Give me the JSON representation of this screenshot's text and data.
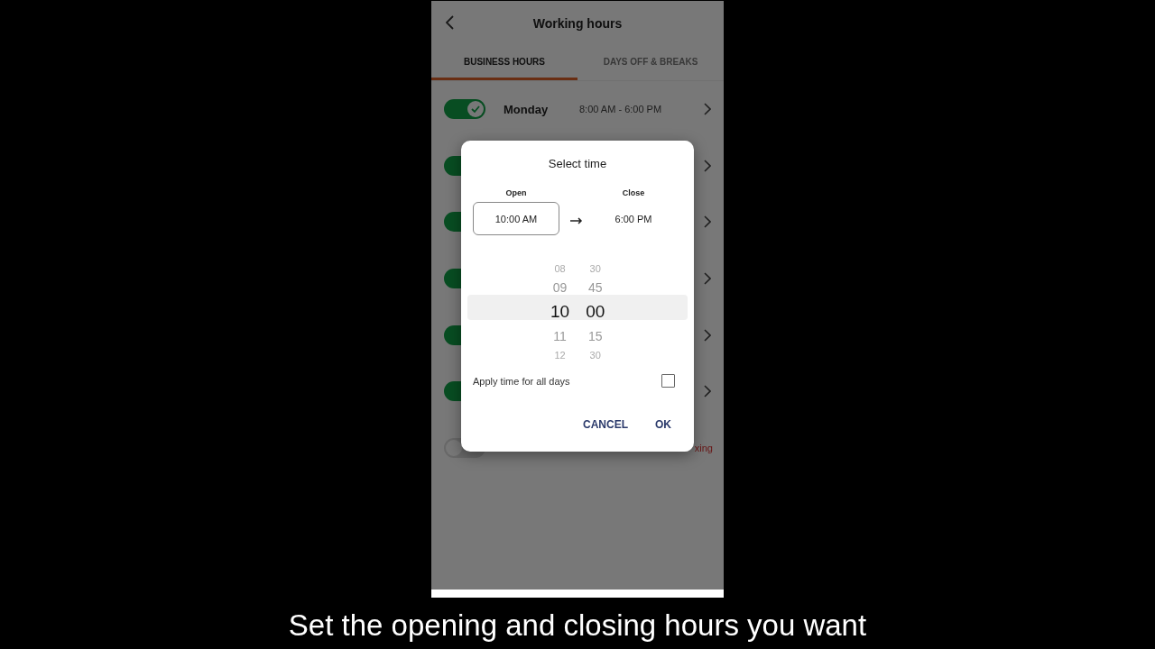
{
  "header": {
    "title": "Working hours"
  },
  "tabs": [
    {
      "label": "BUSINESS HOURS",
      "selected": true
    },
    {
      "label": "DAYS OFF & BREAKS",
      "selected": false
    }
  ],
  "days": [
    {
      "name": "Monday",
      "hours": "8:00 AM  - 6:00 PM",
      "on": true
    },
    {
      "on": true
    },
    {
      "on": true
    },
    {
      "on": true
    },
    {
      "on": true
    },
    {
      "on": true
    }
  ],
  "footer_row": {
    "on": false,
    "text": "xing"
  },
  "dialog": {
    "title": "Select time",
    "open_label": "Open",
    "open_value": "10:00 AM",
    "close_label": "Close",
    "close_value": "6:00 PM",
    "hours": [
      {
        "label": "08",
        "selected": false
      },
      {
        "label": "09",
        "selected": false
      },
      {
        "label": "10",
        "selected": true
      },
      {
        "label": "11",
        "selected": false
      },
      {
        "label": "12",
        "selected": false
      }
    ],
    "minutes": [
      {
        "label": "30",
        "selected": false
      },
      {
        "label": "45",
        "selected": false
      },
      {
        "label": "00",
        "selected": true
      },
      {
        "label": "15",
        "selected": false
      },
      {
        "label": "30",
        "selected": false
      }
    ],
    "apply_label": "Apply time for all days",
    "apply_checked": false,
    "buttons": [
      "CANCEL",
      "OK"
    ]
  },
  "caption": "Set the opening and closing hours you want"
}
